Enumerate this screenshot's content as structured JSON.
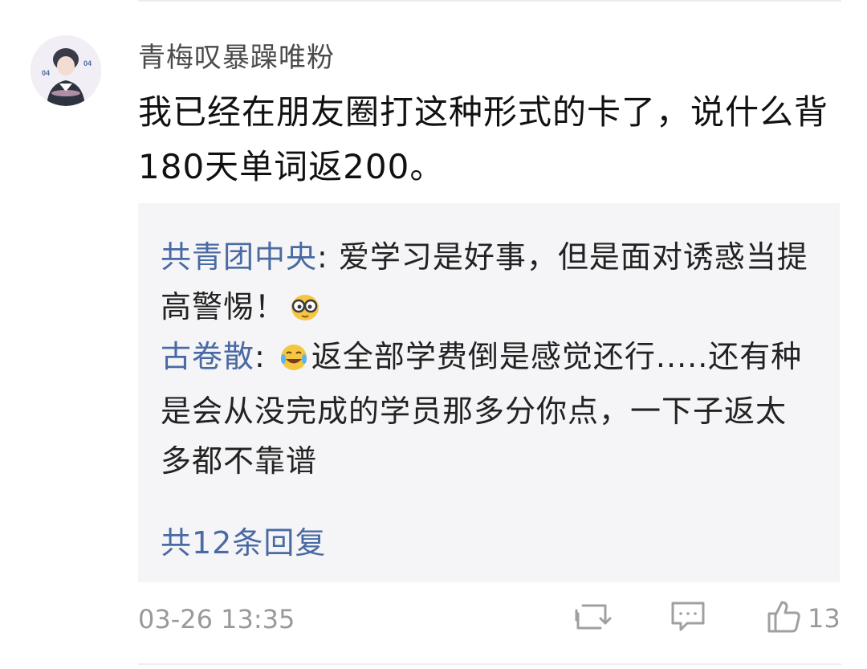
{
  "comment": {
    "username": "青梅叹暴躁唯粉",
    "text": "我已经在朋友圈打这种形式的卡了，说什么背180天单词返200。",
    "timestamp": "03-26 13:35",
    "like_count": "13"
  },
  "replies": [
    {
      "author": "共青团中央",
      "separator": ": ",
      "text": "爱学习是好事，但是面对诱惑当提高警惕！",
      "emoji_after": "glasses-face-emoji"
    },
    {
      "author": "古卷散",
      "separator": ": ",
      "emoji_before": "crying-laughing-emoji",
      "text": "返全部学费倒是感觉还行.....还有种是会从没完成的学员那多分你点，一下子返太多都不靠谱"
    }
  ],
  "more_replies": "共12条回复",
  "icons": {
    "repost": "repost-icon",
    "comment": "comment-icon",
    "like": "thumbs-up-icon"
  },
  "colors": {
    "author_link": "#4a6aa3",
    "reply_background": "#f5f5f7",
    "muted_text": "#999999"
  }
}
